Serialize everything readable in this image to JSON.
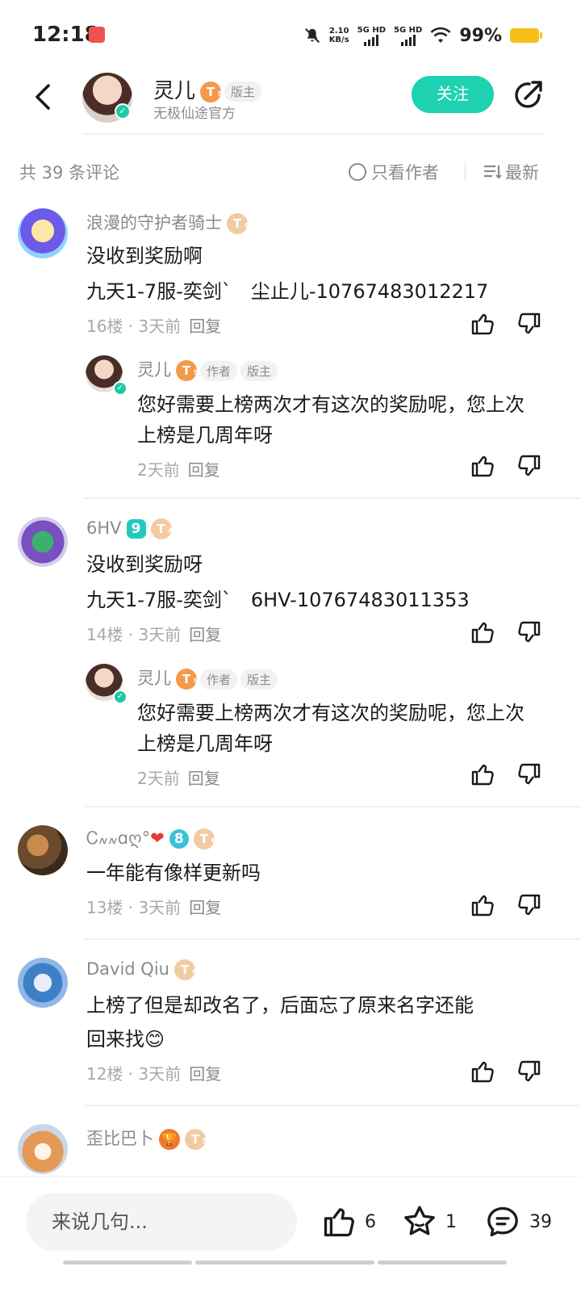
{
  "status_bar": {
    "time": "12:18",
    "net_speed_value": "2.10",
    "net_speed_unit": "KB/s",
    "sim1": "5G HD",
    "sim2": "5G HD",
    "battery": "99%",
    "battery_color": "#f6c018"
  },
  "header": {
    "name": "灵儿",
    "level": "T",
    "level_sub": "9",
    "role_tag": "版主",
    "subtitle": "无极仙途官方",
    "follow_label": "关注",
    "accent": "#1ed1b1"
  },
  "sort": {
    "count_label": "共 39 条评论",
    "only_author": "只看作者",
    "order": "最新"
  },
  "comments": [
    {
      "user": "浪漫的守护者骑士",
      "level_sub": "4",
      "line1": "没收到奖励啊",
      "line2": "九天1-7服-奕剑ˋ　尘止儿-10767483012217",
      "floor": "16楼 · 3天前",
      "reply_label": "回复",
      "reply": {
        "user": "灵儿",
        "level_sub": "9",
        "tag_author": "作者",
        "tag_mod": "版主",
        "text": "您好需要上榜两次才有这次的奖励呢，您上次上榜是几周年呀",
        "time": "2天前",
        "reply_label": "回复"
      }
    },
    {
      "user": "6HV",
      "badge": "9",
      "level_sub": "4",
      "line1": "没收到奖励呀",
      "line2": "九天1-7服-奕剑ˋ　6HV-10767483011353",
      "floor": "14楼 · 3天前",
      "reply_label": "回复",
      "reply": {
        "user": "灵儿",
        "level_sub": "9",
        "tag_author": "作者",
        "tag_mod": "版主",
        "text": "您好需要上榜两次才有这次的奖励呢，您上次上榜是几周年呀",
        "time": "2天前",
        "reply_label": "回复"
      }
    },
    {
      "user": "Ꮯ៷៷ɑღ°",
      "heart": "❤",
      "badge": "8",
      "level_sub": "6",
      "line1": "一年能有像样更新吗",
      "floor": "13楼 · 3天前",
      "reply_label": "回复"
    },
    {
      "user": "David Qiu",
      "level_sub": "4",
      "line1": "上榜了但是却改名了，后面忘了原来名字还能",
      "line2": "回来找😊",
      "floor": "12楼 · 3天前",
      "reply_label": "回复"
    },
    {
      "user": "歪比巴卜",
      "level_sub": "5"
    }
  ],
  "bottom": {
    "input_placeholder": "来说几句...",
    "likes": "6",
    "favorites": "1",
    "comments": "39"
  }
}
